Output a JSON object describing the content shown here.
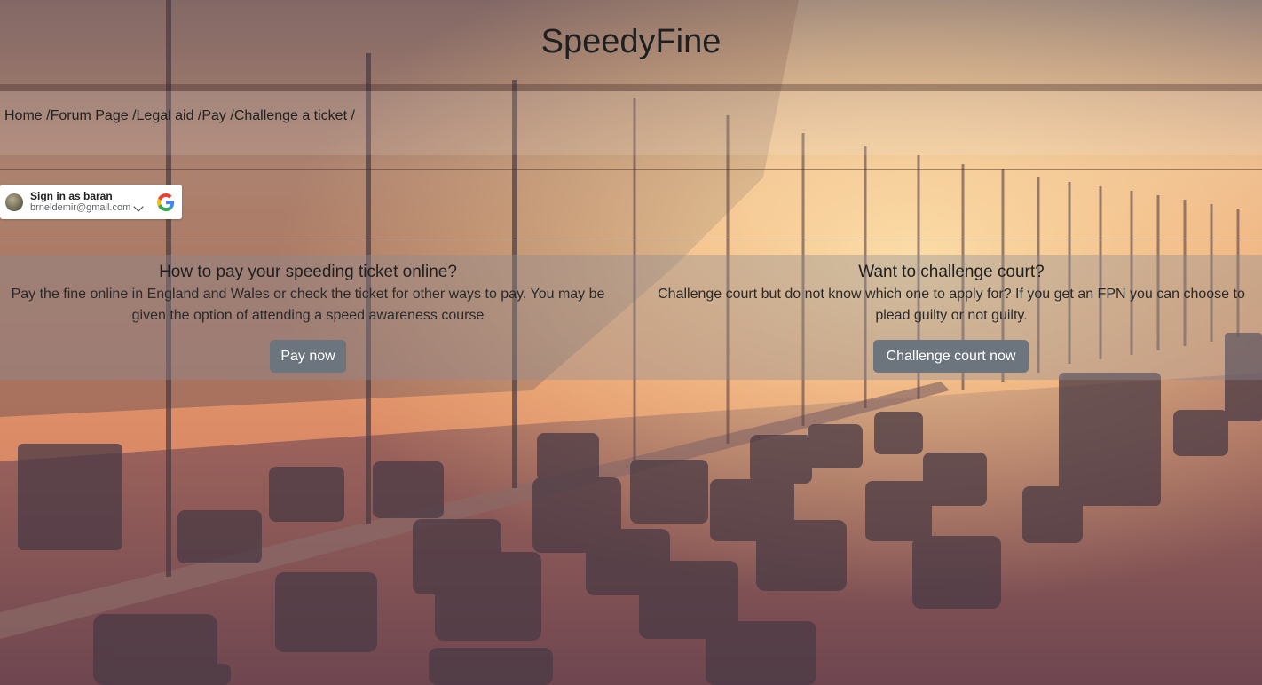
{
  "app": {
    "title": "SpeedyFine"
  },
  "breadcrumb": [
    "Home /",
    "Forum Page /",
    "Legal aid /",
    "Pay /",
    "Challenge a ticket /"
  ],
  "google_signin": {
    "line1": "Sign in as baran",
    "email": "brneldemir@gmail.com",
    "icons": [
      "avatar",
      "chevron-down-icon",
      "google-logo-icon"
    ]
  },
  "pay_section": {
    "heading": "How to pay your speeding ticket online?",
    "body": "Pay the fine online in England and Wales or check the ticket for other ways to pay. You may be given the option of attending a speed awareness course",
    "button": "Pay now"
  },
  "court_section": {
    "heading": "Want to challenge court?",
    "body": "Challenge court but do not know which one to apply for? If you get an FPN you can choose to plead guilty or not guilty.",
    "button": "Challenge court now"
  },
  "colors": {
    "button_bg": "#6c757d",
    "button_text": "#ffffff",
    "title_text": "#1f1f1f"
  }
}
